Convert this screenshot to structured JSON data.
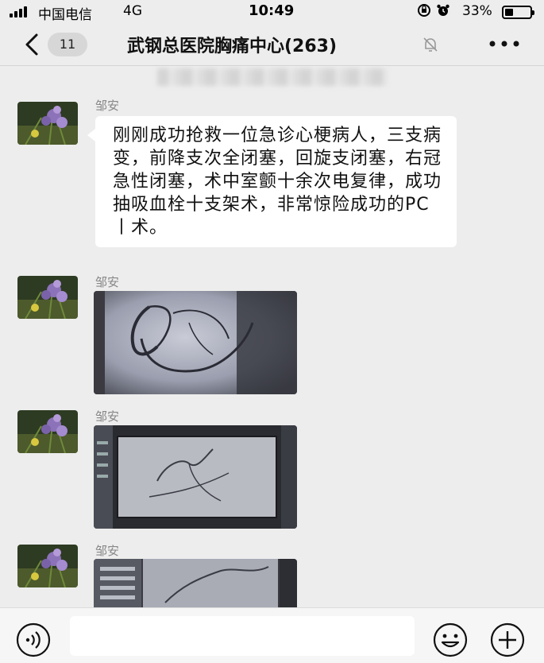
{
  "status_bar": {
    "carrier": "中国电信",
    "network": "4G",
    "time": "10:49",
    "battery_percent": "33%",
    "battery_level": 0.33,
    "icons": [
      "signal-icon",
      "lock-rotation-icon",
      "alarm-icon",
      "battery-icon"
    ]
  },
  "header": {
    "back_icon": "chevron-left-icon",
    "unread_badge": "11",
    "title": "武钢总医院胸痛中心(263)",
    "mute_icon": "bell-muted-icon",
    "more_icon": "ellipsis-icon"
  },
  "messages": [
    {
      "sender": "邹安",
      "type": "text",
      "text": "刚刚成功抢救一位急诊心梗病人，三支病变，前降支次全闭塞，回旋支闭塞，右冠急性闭塞，术中室颤十余次电复律，成功抽吸血栓十支架术，非常惊险成功的PC丨术。"
    },
    {
      "sender": "邹安",
      "type": "image",
      "image": "angiogram-image"
    },
    {
      "sender": "邹安",
      "type": "image",
      "image": "angiogram-monitor-photo"
    },
    {
      "sender": "邹安",
      "type": "image",
      "image": "angiogram-monitor-photo"
    }
  ],
  "input_bar": {
    "voice_icon": "voice-icon",
    "input_value": "",
    "emoji_icon": "smiley-icon",
    "plus_icon": "plus-circle-icon"
  },
  "colors": {
    "background": "#ededed",
    "bubble": "#ffffff",
    "sender": "#888888",
    "badge": "#d7d7d7"
  }
}
